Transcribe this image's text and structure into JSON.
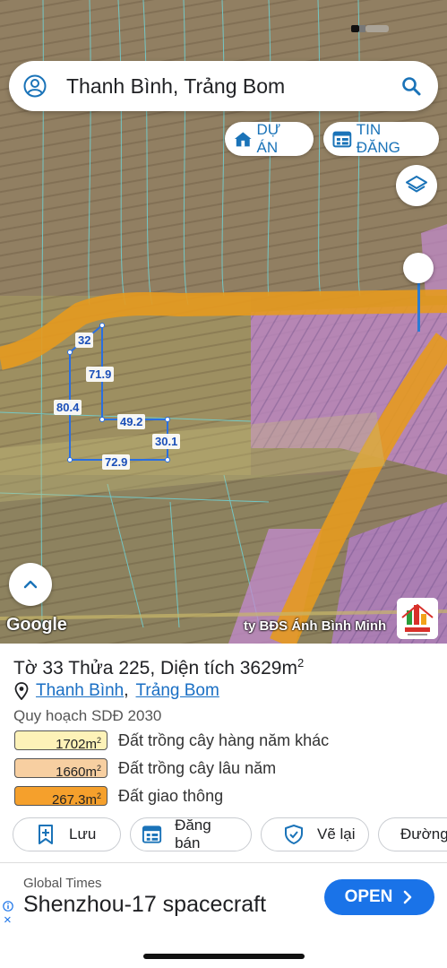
{
  "search": {
    "query": "Thanh Bình, Trảng Bom"
  },
  "chips": {
    "project": "DỰ ÁN",
    "news": "TIN ĐĂNG"
  },
  "plot": {
    "dimensions": [
      "32",
      "71.9",
      "80.4",
      "49.2",
      "30.1",
      "72.9"
    ]
  },
  "map": {
    "google_logo": "Google",
    "watermark": "ty BĐS Ánh Bình Minh"
  },
  "panel": {
    "title_prefix": "Tờ 33 Thửa 225, Diện tích 3629m",
    "title_sup": "2",
    "location": {
      "ward": "Thanh Bình",
      "separator": ",",
      "district": "Trảng Bom"
    },
    "plan_title": "Quy hoạch SDĐ 2030",
    "legend": [
      {
        "area": "1702m",
        "label": "Đất trồng cây hàng năm khác",
        "color": "#fdf2b8"
      },
      {
        "area": "1660m",
        "label": "Đất trồng cây lâu năm",
        "color": "#f7cfa1"
      },
      {
        "area": "267.3m",
        "label": "Đất giao thông",
        "color": "#f5a02c"
      }
    ],
    "area_unit_sup": "2",
    "actions": [
      "Lưu",
      "Đăng bán",
      "Vẽ lại",
      "Đường"
    ]
  },
  "ad": {
    "source": "Global Times",
    "headline": "Shenzhou-17 spacecraft",
    "cta": "OPEN",
    "close": "×"
  },
  "colors": {
    "accent": "#1a73e8",
    "road": "#e69a1f",
    "zone_purple": "#c38ad0",
    "plot_outline": "#2a6fe0"
  }
}
